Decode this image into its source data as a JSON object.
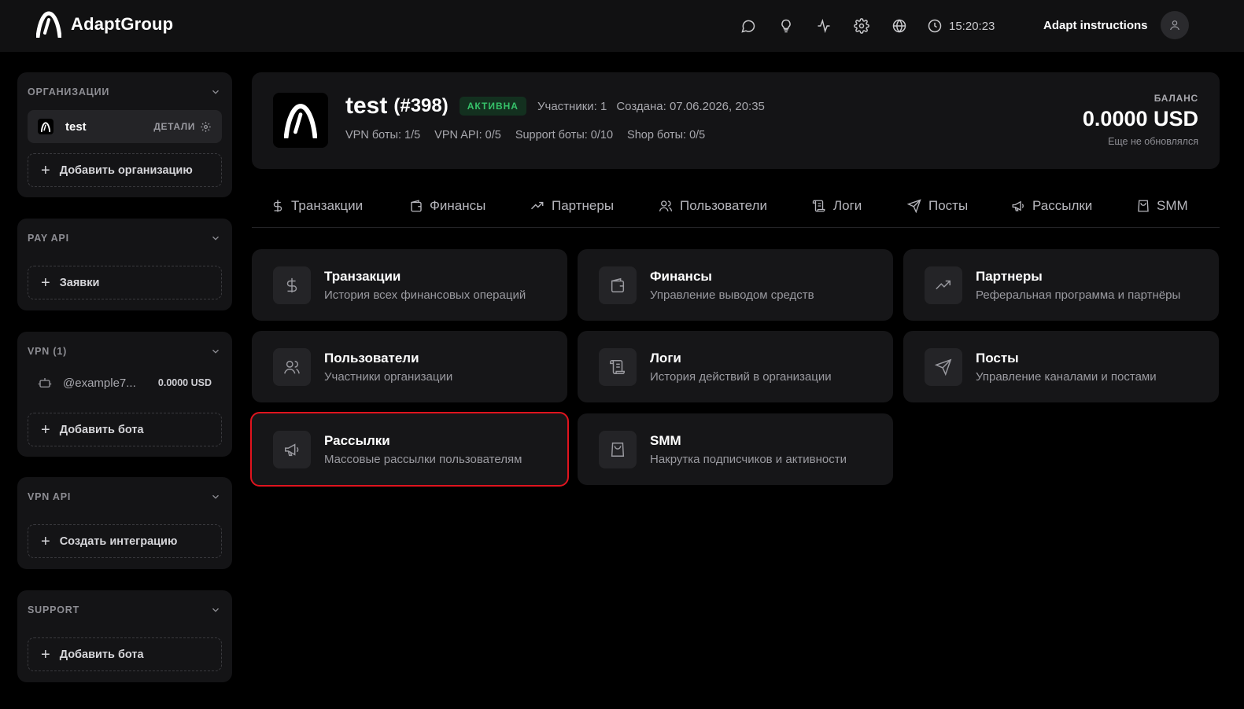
{
  "header": {
    "brand": "AdaptGroup",
    "time": "15:20:23",
    "user_name": "Adapt instructions",
    "icons": [
      "chat-icon",
      "lightbulb-icon",
      "activity-icon",
      "gear-icon",
      "globe-icon",
      "clock-icon"
    ]
  },
  "sidebar": {
    "organizations": {
      "title": "ОРГАНИЗАЦИИ",
      "org_name": "test",
      "details_label": "ДЕТАЛИ",
      "add_label": "Добавить организацию"
    },
    "pay_api": {
      "title": "PAY API",
      "add_label": "Заявки"
    },
    "vpn": {
      "title": "VPN (1)",
      "bot_name": "@example7...",
      "bot_balance": "0.0000 USD",
      "add_label": "Добавить бота"
    },
    "vpn_api": {
      "title": "VPN API",
      "add_label": "Создать интеграцию"
    },
    "support": {
      "title": "SUPPORT",
      "add_label": "Добавить бота"
    }
  },
  "org": {
    "name": "test",
    "id": "(#398)",
    "status": "АКТИВНА",
    "members": "Участники: 1",
    "created": "Создана: 07.06.2026, 20:35",
    "stats": [
      "VPN боты: 1/5",
      "VPN API: 0/5",
      "Support боты: 0/10",
      "Shop боты: 0/5"
    ],
    "balance_label": "БАЛАНС",
    "balance_value": "0.0000 USD",
    "balance_note": "Еще не обновлялся"
  },
  "tabs": [
    "Транзакции",
    "Финансы",
    "Партнеры",
    "Пользователи",
    "Логи",
    "Посты",
    "Рассылки",
    "SMM"
  ],
  "cards": [
    {
      "title": "Транзакции",
      "desc": "История всех финансовых операций",
      "icon": "dollar-icon"
    },
    {
      "title": "Финансы",
      "desc": "Управление выводом средств",
      "icon": "wallet-icon"
    },
    {
      "title": "Партнеры",
      "desc": "Реферальная программа и партнёры",
      "icon": "trending-up-icon"
    },
    {
      "title": "Пользователи",
      "desc": "Участники организации",
      "icon": "users-icon"
    },
    {
      "title": "Логи",
      "desc": "История действий в организации",
      "icon": "scroll-icon"
    },
    {
      "title": "Посты",
      "desc": "Управление каналами и постами",
      "icon": "send-icon"
    },
    {
      "title": "Рассылки",
      "desc": "Массовые рассылки пользователям",
      "icon": "megaphone-icon"
    },
    {
      "title": "SMM",
      "desc": "Накрутка подписчиков и активности",
      "icon": "shopping-bag-icon"
    }
  ],
  "colors": {
    "accent_green": "#36c26a",
    "selection_red": "#e0141e"
  }
}
